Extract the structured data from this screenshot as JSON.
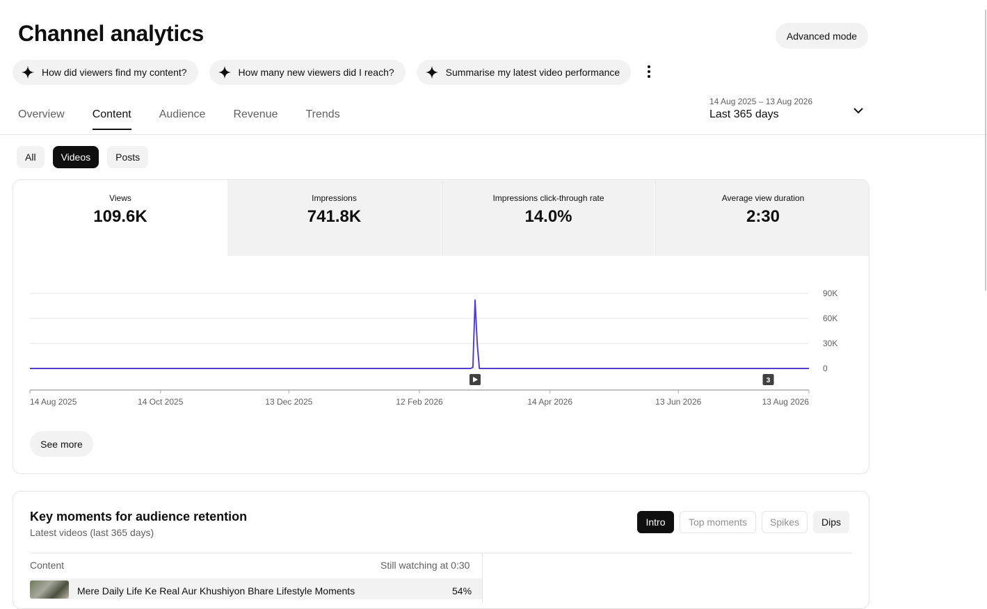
{
  "header": {
    "title": "Channel analytics",
    "advanced_mode_label": "Advanced mode"
  },
  "suggestions": [
    {
      "label": "How did viewers find my content?",
      "icon": "sparkle-icon"
    },
    {
      "label": "How many new viewers did I reach?",
      "icon": "sparkle-icon"
    },
    {
      "label": "Summarise my latest video performance",
      "icon": "sparkle-icon"
    }
  ],
  "tabs": [
    {
      "label": "Overview",
      "active": false
    },
    {
      "label": "Content",
      "active": true
    },
    {
      "label": "Audience",
      "active": false
    },
    {
      "label": "Revenue",
      "active": false
    },
    {
      "label": "Trends",
      "active": false
    }
  ],
  "date_range": {
    "range": "14 Aug 2025 – 13 Aug 2026",
    "label": "Last 365 days"
  },
  "filters": [
    {
      "label": "All",
      "active": false
    },
    {
      "label": "Videos",
      "active": true
    },
    {
      "label": "Posts",
      "active": false
    }
  ],
  "metrics": [
    {
      "label": "Views",
      "value": "109.6K",
      "active": true
    },
    {
      "label": "Impressions",
      "value": "741.8K",
      "active": false
    },
    {
      "label": "Impressions click-through rate",
      "value": "14.0%",
      "active": false
    },
    {
      "label": "Average view duration",
      "value": "2:30",
      "active": false
    }
  ],
  "chart_data": {
    "type": "line",
    "series": [
      {
        "color": "#5140c8",
        "points": [
          [
            "2025-08-14",
            0
          ],
          [
            "2026-03-08",
            0
          ],
          [
            "2026-03-09",
            1500
          ],
          [
            "2026-03-10",
            82000
          ],
          [
            "2026-03-11",
            30000
          ],
          [
            "2026-03-12",
            0
          ],
          [
            "2026-08-13",
            0
          ]
        ]
      }
    ],
    "x_ticks": [
      "14 Aug 2025",
      "14 Oct 2025",
      "13 Dec 2025",
      "12 Feb 2026",
      "14 Apr 2026",
      "13 Jun 2026",
      "13 Aug 2026"
    ],
    "y_ticks": [
      "0",
      "30K",
      "60K",
      "90K"
    ],
    "ylim": [
      0,
      90000
    ],
    "xlim": [
      "2025-08-14",
      "2026-08-13"
    ],
    "grid": true,
    "markers": [
      {
        "date": "2026-03-10",
        "type": "video-marker-icon",
        "label": ""
      },
      {
        "date": "2026-07-25",
        "type": "count-marker",
        "label": "3"
      }
    ]
  },
  "see_more_label": "See more",
  "key_moments": {
    "title": "Key moments for audience retention",
    "subtitle": "Latest videos (last 365 days)",
    "segments": [
      {
        "label": "Intro",
        "state": "on"
      },
      {
        "label": "Top moments",
        "state": "off"
      },
      {
        "label": "Spikes",
        "state": "off"
      },
      {
        "label": "Dips",
        "state": "dips"
      }
    ],
    "col_content": "Content",
    "col_still": "Still watching at 0:30",
    "rows": [
      {
        "title": "Mere Daily Life Ke Real Aur Khushiyon Bhare Lifestyle Moments",
        "value": "54%"
      }
    ]
  },
  "colors": {
    "line": "#5140c8",
    "chip_bg": "#f2f2f2",
    "text": "#0f0f0f",
    "muted": "#606060"
  }
}
